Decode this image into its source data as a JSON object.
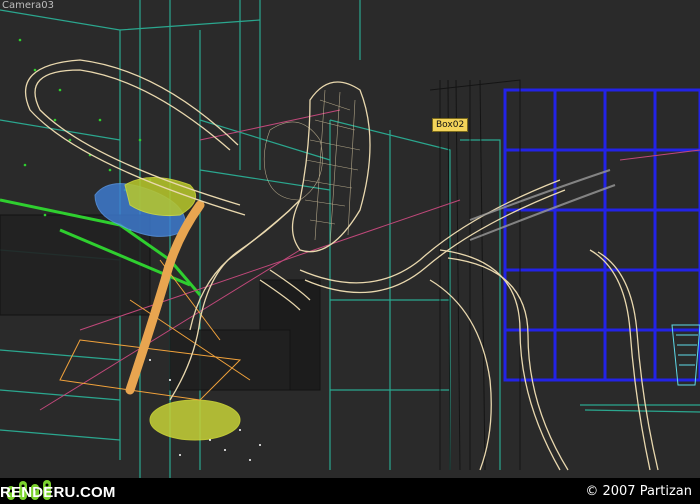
{
  "viewport": {
    "camera_label": "Camera03",
    "selected_object_label": "Box02"
  },
  "footer": {
    "brand": "RENDERU.COM",
    "copyright": "© 2007 Partizan"
  },
  "colors": {
    "background": "#2a2a2a",
    "wire_beige": "#e9d8ae",
    "wire_teal": "#2bb59a",
    "wire_blue": "#2323e6",
    "wire_green": "#2fcf2f",
    "wire_yellow": "#d8e23a",
    "wire_orange": "#f1a23b",
    "wire_pink": "#c0487a",
    "label_yellow": "#f3d45a",
    "brand_green": "#7bd12e"
  }
}
